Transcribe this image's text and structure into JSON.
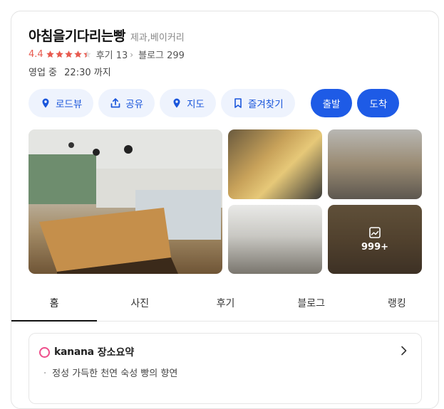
{
  "place": {
    "title": "아침을기다리는빵",
    "category": "제과,베이커리",
    "rating": "4.4",
    "stars_value": 4.4,
    "reviews_label": "후기 13",
    "blog_label": "블로그 299",
    "hours_status": "영업 중",
    "hours_until": "22:30 까지"
  },
  "actions": [
    {
      "label": "로드뷰",
      "icon": "roadview-pin-icon"
    },
    {
      "label": "공유",
      "icon": "share-icon"
    },
    {
      "label": "지도",
      "icon": "map-pin-icon"
    },
    {
      "label": "즐겨찾기",
      "icon": "bookmark-icon"
    }
  ],
  "primary_actions": {
    "depart": "출발",
    "arrive": "도착"
  },
  "gallery": {
    "more_count": "999+"
  },
  "tabs": [
    "홈",
    "사진",
    "후기",
    "블로그",
    "랭킹"
  ],
  "summary": {
    "brand": "kanana",
    "title": "장소요약",
    "line": "정성 가득한 천연 숙성 빵의 향연"
  },
  "colors": {
    "accent": "#1e5be6",
    "rating": "#e85a4f",
    "brand_ring": "#ee4e8b"
  }
}
